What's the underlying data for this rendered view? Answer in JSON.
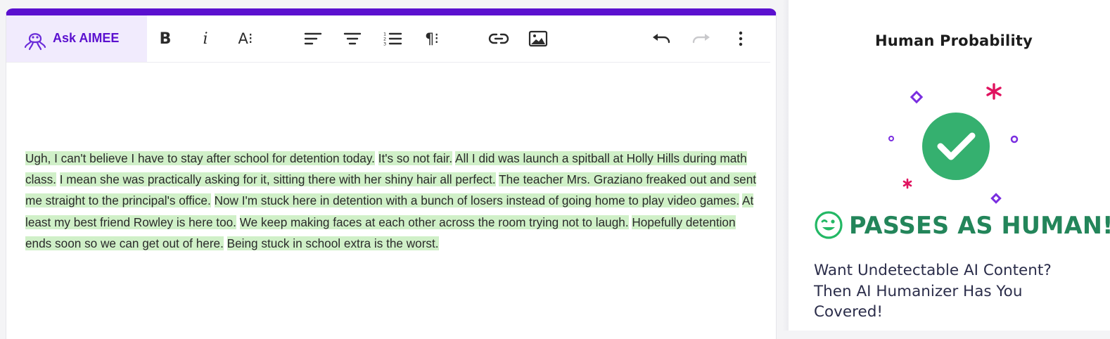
{
  "editor": {
    "ask_label": "Ask AIMEE",
    "toolbar": {
      "bold": "B",
      "italic": "i",
      "font_size": "A⁝",
      "paragraph": "¶⁝"
    },
    "sentences": [
      "Ugh, I can't believe I have to stay after school for detention today.",
      "It's so not fair.",
      "All I did was launch a spitball at Holly Hills during math class.",
      "I mean she was practically asking for it, sitting there with her shiny hair all perfect.",
      "The teacher Mrs. Graziano freaked out and sent me straight to the principal's office.",
      "Now I'm stuck here in detention with a bunch of losers instead of going home to play video games.",
      "At least my best friend Rowley is here too.",
      "We keep making faces at each other across the room trying not to laugh.",
      "Hopefully detention ends soon so we can get out of here.",
      "Being stuck in school extra is the worst."
    ],
    "highlight_color": "#d0f0c8",
    "accent_color": "#5b10cf"
  },
  "panel": {
    "title": "Human Probability",
    "verdict": "PASSES AS HUMAN!",
    "verdict_color": "#23855a",
    "verdict_icon": "winking-face-icon",
    "check_icon": "checkmark-circle-icon",
    "promo": "Want Undetectable AI Content? Then AI Humanizer Has You Covered!"
  }
}
